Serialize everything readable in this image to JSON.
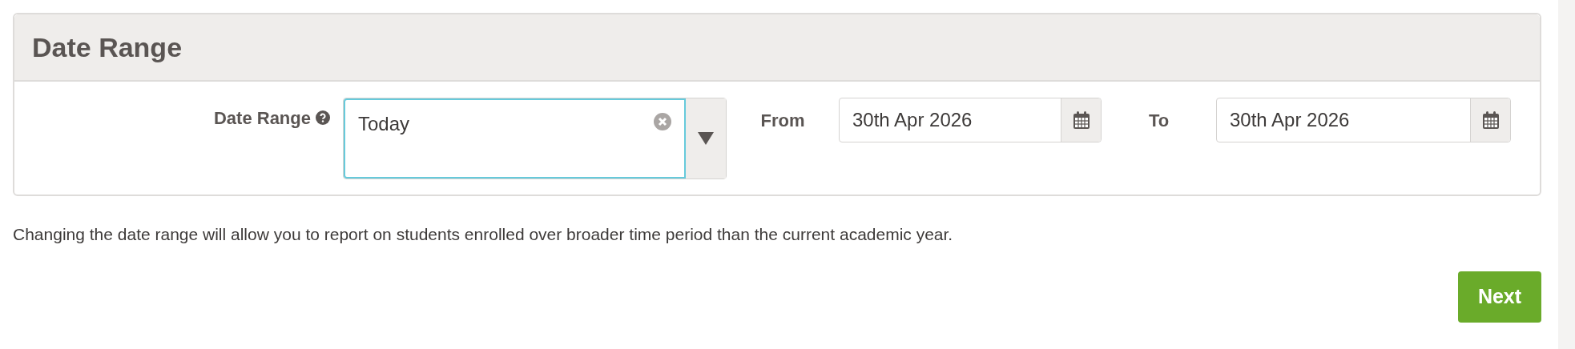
{
  "panel": {
    "title": "Date Range"
  },
  "date_range": {
    "label": "Date Range",
    "value": "Today"
  },
  "from": {
    "label": "From",
    "value": "30th Apr 2026"
  },
  "to": {
    "label": "To",
    "value": "30th Apr 2026"
  },
  "help_text": "Changing the date range will allow you to report on students enrolled over broader time period than the current academic year.",
  "next_button": "Next"
}
